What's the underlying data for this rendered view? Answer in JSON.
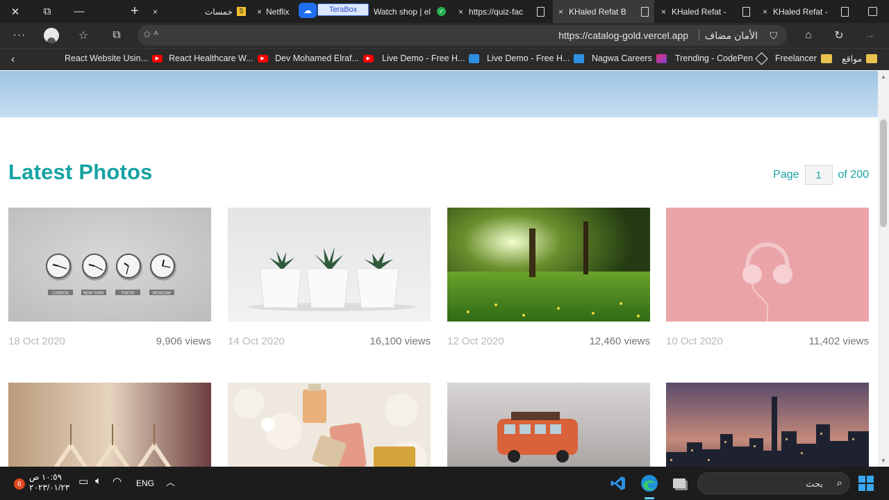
{
  "browser": {
    "tabs": [
      {
        "label": "خمسات",
        "close": "×"
      },
      {
        "label": "Netflix",
        "close": "×"
      },
      {
        "label": "TeraBox"
      },
      {
        "label": "Watch shop | el",
        "close": "×"
      },
      {
        "label": "https://quiz-fac",
        "close": "×"
      },
      {
        "label": "KHaled Refat B",
        "close": "×",
        "active": true
      },
      {
        "label": "KHaled Refat -",
        "close": "×"
      },
      {
        "label": "KHaled Refat -",
        "close": "×"
      }
    ],
    "window_controls": {
      "close": "✕",
      "restore": "⧉",
      "minimize": "—",
      "new_tab": "+"
    },
    "address": {
      "url": "https://catalog-gold.vercel.app",
      "security_label": "الأمان مضاف"
    },
    "bookmarks": [
      {
        "label": "React Website Usin...",
        "icon": "youtube-icon"
      },
      {
        "label": "React Healthcare W...",
        "icon": "youtube-icon"
      },
      {
        "label": "Dev Mohamed Elraf...",
        "icon": "youtube-icon"
      },
      {
        "label": "Live Demo - Free H...",
        "icon": "site-icon"
      },
      {
        "label": "Live Demo - Free H...",
        "icon": "site-icon"
      },
      {
        "label": "Nagwa Careers",
        "icon": "nagwa-icon"
      },
      {
        "label": "Trending - CodePen",
        "icon": "codepen-icon"
      },
      {
        "label": "Freelancer",
        "icon": "folder-icon"
      },
      {
        "label": "مواقع",
        "icon": "folder-icon"
      }
    ]
  },
  "page": {
    "title": "Latest Photos",
    "pager": {
      "prefix": "Page",
      "current": "1",
      "suffix": "of 200"
    },
    "photos": [
      {
        "date": "18 Oct 2020",
        "views": "9,906 views",
        "subject": "clocks"
      },
      {
        "date": "14 Oct 2020",
        "views": "16,100 views",
        "subject": "plants"
      },
      {
        "date": "12 Oct 2020",
        "views": "12,460 views",
        "subject": "meadow"
      },
      {
        "date": "10 Oct 2020",
        "views": "11,402 views",
        "subject": "headphones"
      },
      {
        "subject": "hangers"
      },
      {
        "subject": "perfumes"
      },
      {
        "subject": "toy-bus"
      },
      {
        "subject": "city-skyline"
      }
    ],
    "clock_labels": [
      "LONDON",
      "NEW YORK",
      "TOKYO",
      "MOSCOW"
    ]
  },
  "taskbar": {
    "time": "١٠:٥٩ ص",
    "date": "٢٠٢٣/٠١/٢٣",
    "language": "ENG",
    "search_placeholder": "بحث",
    "notification_count": "6"
  },
  "colors": {
    "accent": "#17a2a2",
    "chrome_dark": "#202020",
    "taskbar": "#1c1c1c"
  }
}
